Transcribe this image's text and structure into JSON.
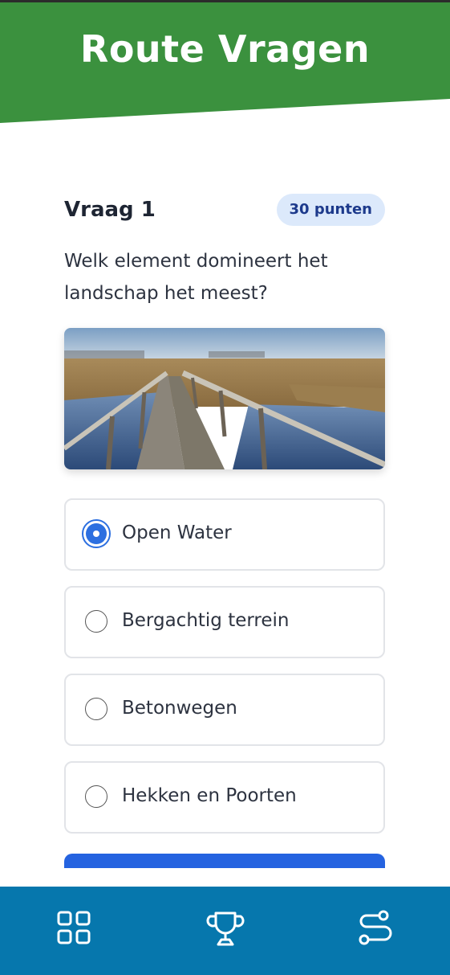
{
  "header": {
    "title": "Route Vragen"
  },
  "question": {
    "title": "Vraag 1",
    "points": "30 punten",
    "text": "Welk element domineert het landschap het meest?",
    "image": "boardwalk-wetland-photo"
  },
  "options": [
    {
      "label": "Open Water",
      "selected": true
    },
    {
      "label": "Bergachtig terrein",
      "selected": false
    },
    {
      "label": "Betonwegen",
      "selected": false
    },
    {
      "label": "Hekken en Poorten",
      "selected": false
    }
  ],
  "nav": {
    "items": [
      {
        "icon": "grid-icon"
      },
      {
        "icon": "trophy-icon"
      },
      {
        "icon": "route-icon"
      }
    ]
  },
  "colors": {
    "header": "#3b913e",
    "accent": "#2563e0",
    "badge_bg": "#dce9fb",
    "nav_bg": "#0677ad"
  }
}
